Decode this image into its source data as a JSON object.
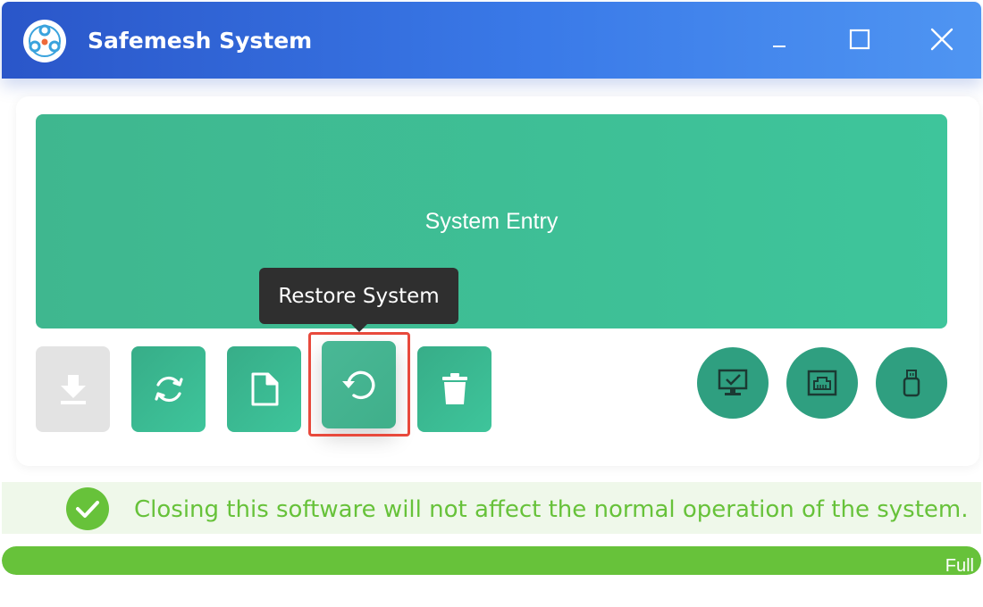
{
  "window": {
    "title": "Safemesh System",
    "accent_gradient": [
      "#2a56c9",
      "#4f95f2"
    ]
  },
  "main": {
    "entry_label": "System Entry",
    "entry_color": "#3ec59b"
  },
  "toolbar": {
    "buttons": [
      {
        "icon": "download-icon",
        "state": "disabled"
      },
      {
        "icon": "sync-icon",
        "state": "enabled"
      },
      {
        "icon": "document-icon",
        "state": "enabled"
      },
      {
        "icon": "restore-icon",
        "state": "hover"
      },
      {
        "icon": "trash-icon",
        "state": "enabled"
      }
    ],
    "tooltip": "Restore System",
    "round_buttons": [
      {
        "icon": "monitor-check-icon"
      },
      {
        "icon": "network-port-icon"
      },
      {
        "icon": "usb-drive-icon"
      }
    ]
  },
  "status": {
    "message": "Closing this software will not affect the normal operation of the system.",
    "icon": "check-circle-icon",
    "color": "#67c23a"
  },
  "progress": {
    "label": "Full",
    "percent": 100,
    "color": "#67c23a"
  }
}
